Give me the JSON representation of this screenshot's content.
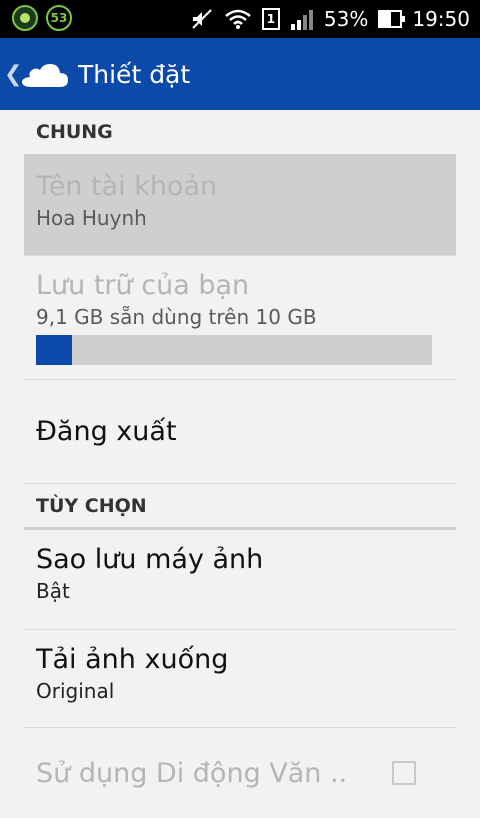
{
  "status_bar": {
    "notif_badge": "53",
    "sim": "1",
    "battery_percent": "53%",
    "battery_level": 0.53,
    "time": "19:50"
  },
  "app_bar": {
    "title": "Thiết đặt"
  },
  "sections": {
    "general": {
      "header": "CHUNG"
    },
    "options": {
      "header": "TÙY CHỌN"
    }
  },
  "account": {
    "title": "Tên tài khoản",
    "value": "Hoa Huynh"
  },
  "storage": {
    "title": "Lưu trữ của bạn",
    "value": "9,1 GB sẵn dùng trên 10 GB",
    "used_fraction": 0.09
  },
  "logout": {
    "title": "Đăng xuất"
  },
  "camera_backup": {
    "title": "Sao lưu máy ảnh",
    "value": "Bật"
  },
  "download_photos": {
    "title": "Tải ảnh xuống",
    "value": "Original"
  },
  "mobile_data": {
    "title": "Sử dụng Di động Văn ..",
    "checked": false
  },
  "colors": {
    "accent": "#0b4aa8",
    "status_bar": "#000000"
  }
}
